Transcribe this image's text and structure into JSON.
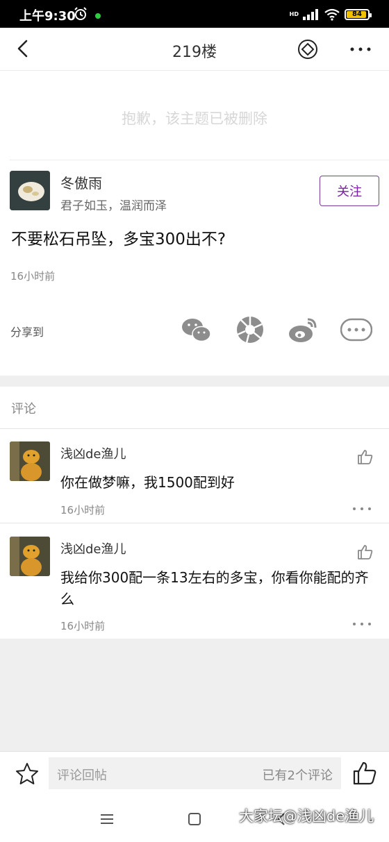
{
  "status_bar": {
    "time": "上午9:30",
    "network": "HD",
    "battery": "84"
  },
  "header": {
    "title": "219楼"
  },
  "deleted_notice": "抱歉，该主题已被删除",
  "post": {
    "author": "冬傲雨",
    "signature": "君子如玉，温润而泽",
    "follow_label": "关注",
    "text": "不要松石吊坠，多宝300出不?",
    "time": "16小时前",
    "share_label": "分享到"
  },
  "comments_heading": "评论",
  "comments": [
    {
      "user": "浅凶de渔儿",
      "text": "你在做梦嘛，我1500配到好",
      "time": "16小时前"
    },
    {
      "user": "浅凶de渔儿",
      "text": "我给你300配一条13左右的多宝，你看你能配的齐么",
      "time": "16小时前"
    }
  ],
  "bottom_bar": {
    "placeholder": "评论回帖",
    "count": "已有2个评论"
  },
  "watermark": "大家坛@浅凶de渔儿",
  "colors": {
    "accent": "#7a1fa2",
    "battery": "#f2c200"
  }
}
